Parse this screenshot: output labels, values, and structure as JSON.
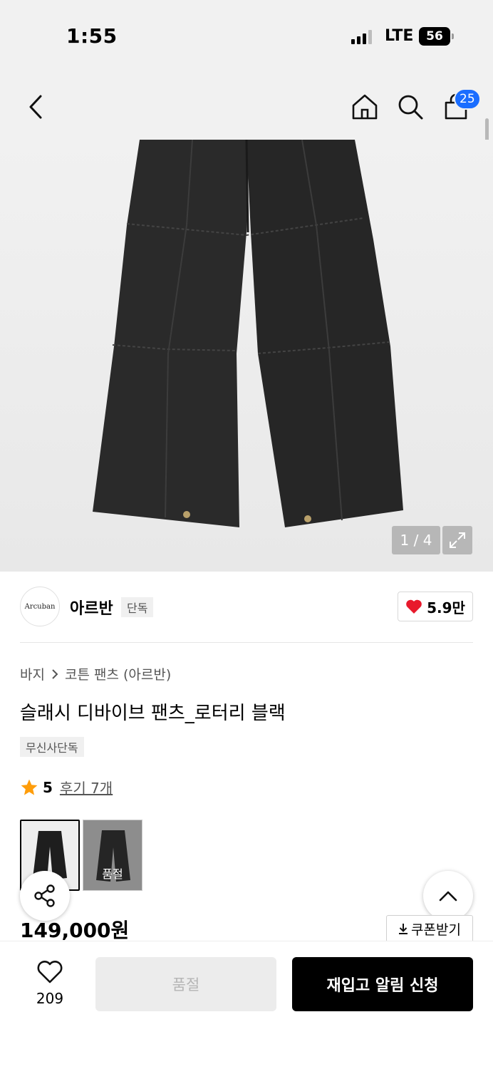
{
  "status_bar": {
    "time": "1:55",
    "network": "LTE",
    "battery": "56"
  },
  "header": {
    "cart_count": "25",
    "icons": [
      "back-icon",
      "home-icon",
      "search-icon",
      "cart-icon"
    ]
  },
  "gallery": {
    "counter": "1 / 4"
  },
  "brand": {
    "logo_text": "Arcuban",
    "name": "아르반",
    "tag": "단독",
    "likes": "5.9만"
  },
  "product": {
    "breadcrumb": [
      "바지",
      "코튼 팬츠 (아르반)"
    ],
    "title": "슬래시 디바이브 팬츠_로터리 블랙",
    "exclusive_tag": "무신사단독",
    "rating": "5",
    "reviews": "후기 7개",
    "options": [
      {
        "name": "black",
        "label": "",
        "selected": true
      },
      {
        "name": "grey",
        "label": "품절",
        "selected": false
      }
    ],
    "price": "149,000원",
    "coupon_label": "쿠폰받기"
  },
  "bottom_bar": {
    "wish_count": "209",
    "soldout_label": "품절",
    "restock_label": "재입고 알림 신청"
  },
  "colors": {
    "accent_blue": "#1a6dff",
    "heart_red": "#e8192c",
    "star_orange": "#ff9d0a"
  }
}
